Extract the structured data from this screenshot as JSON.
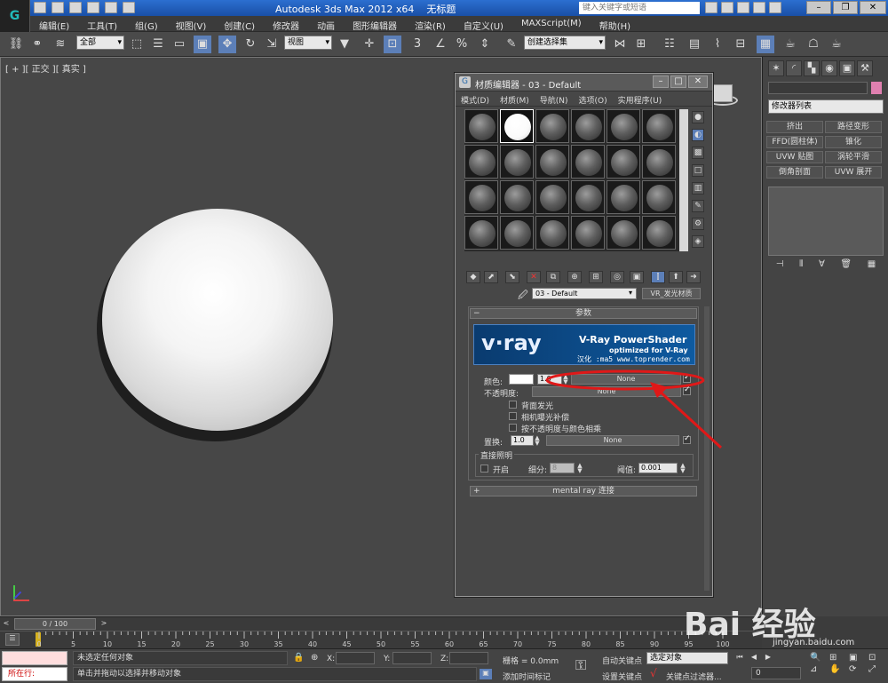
{
  "app": {
    "title": "Autodesk 3ds Max  2012 x64",
    "document": "无标题",
    "search_placeholder": "键入关键字或短语",
    "menu": [
      "编辑(E)",
      "工具(T)",
      "组(G)",
      "视图(V)",
      "创建(C)",
      "修改器",
      "动画",
      "图形编辑器",
      "渲染(R)",
      "自定义(U)",
      "MAXScript(M)",
      "帮助(H)"
    ]
  },
  "toolbar": {
    "selection_filter": "全部",
    "ref_coord": "视图",
    "named_selection": "创建选择集"
  },
  "viewport": {
    "label": "[ + ][ 正交 ][ 真实 ]"
  },
  "command_panel": {
    "modifier_list": "修改器列表",
    "buttons": [
      "挤出",
      "路径变形",
      "FFD(圆柱体)",
      "锥化",
      "UVW 贴图",
      "涡轮平滑",
      "倒角剖面",
      "UVW 展开"
    ]
  },
  "material_editor": {
    "title": "材质编辑器 - 03 - Default",
    "menu": [
      "模式(D)",
      "材质(M)",
      "导航(N)",
      "选项(O)",
      "实用程序(U)"
    ],
    "material_name": "03 - Default",
    "material_type": "VR_发光材质",
    "params_rollout": "参数",
    "vray_banner": {
      "logo": "v·ray",
      "heading": "V-Ray PowerShader",
      "sub": "optimized for V-Ray",
      "credit": "汉化 :ma5 www.toprender.com"
    },
    "color_label": "颜色:",
    "color_value": "1.0",
    "color_map": "None",
    "opacity_label": "不透明度:",
    "opacity_map": "None",
    "options": [
      "背面发光",
      "相机曝光补偿",
      "按不透明度与颜色相乘"
    ],
    "displace_label": "置换:",
    "displace_value": "1.0",
    "displace_map": "None",
    "direct_light_group": "直接照明",
    "on_label": "开启",
    "subdivs_label": "细分:",
    "subdivs_value": "8",
    "threshold_label": "阈值:",
    "threshold_value": "0.001",
    "mental_ray_rollout": "mental ray 连接"
  },
  "timeline": {
    "frame": "0 / 100",
    "ticks": [
      "0",
      "5",
      "10",
      "15",
      "20",
      "25",
      "30",
      "35",
      "40",
      "45",
      "50",
      "55",
      "60",
      "65",
      "70",
      "75",
      "80",
      "85",
      "90",
      "95",
      "100"
    ]
  },
  "status": {
    "mode": "所在行:",
    "line1": "未选定任何对象",
    "line2": "单击并拖动以选择并移动对象",
    "x_label": "X:",
    "y_label": "Y:",
    "z_label": "Z:",
    "grid": "栅格 = 0.0mm",
    "auto_key": "自动关键点",
    "set_key": "设置关键点",
    "selected": "选定对象",
    "add_time_tag": "添加时间标记",
    "key_filters": "关键点过滤器...",
    "frame_value": "0"
  },
  "watermark": {
    "brand": "Bai 经验",
    "url": "jingyan.baidu.com"
  },
  "colors": {
    "title_blue": "#1a4fa6",
    "annotation_red": "#e01818",
    "status_red": "#ffdede"
  }
}
